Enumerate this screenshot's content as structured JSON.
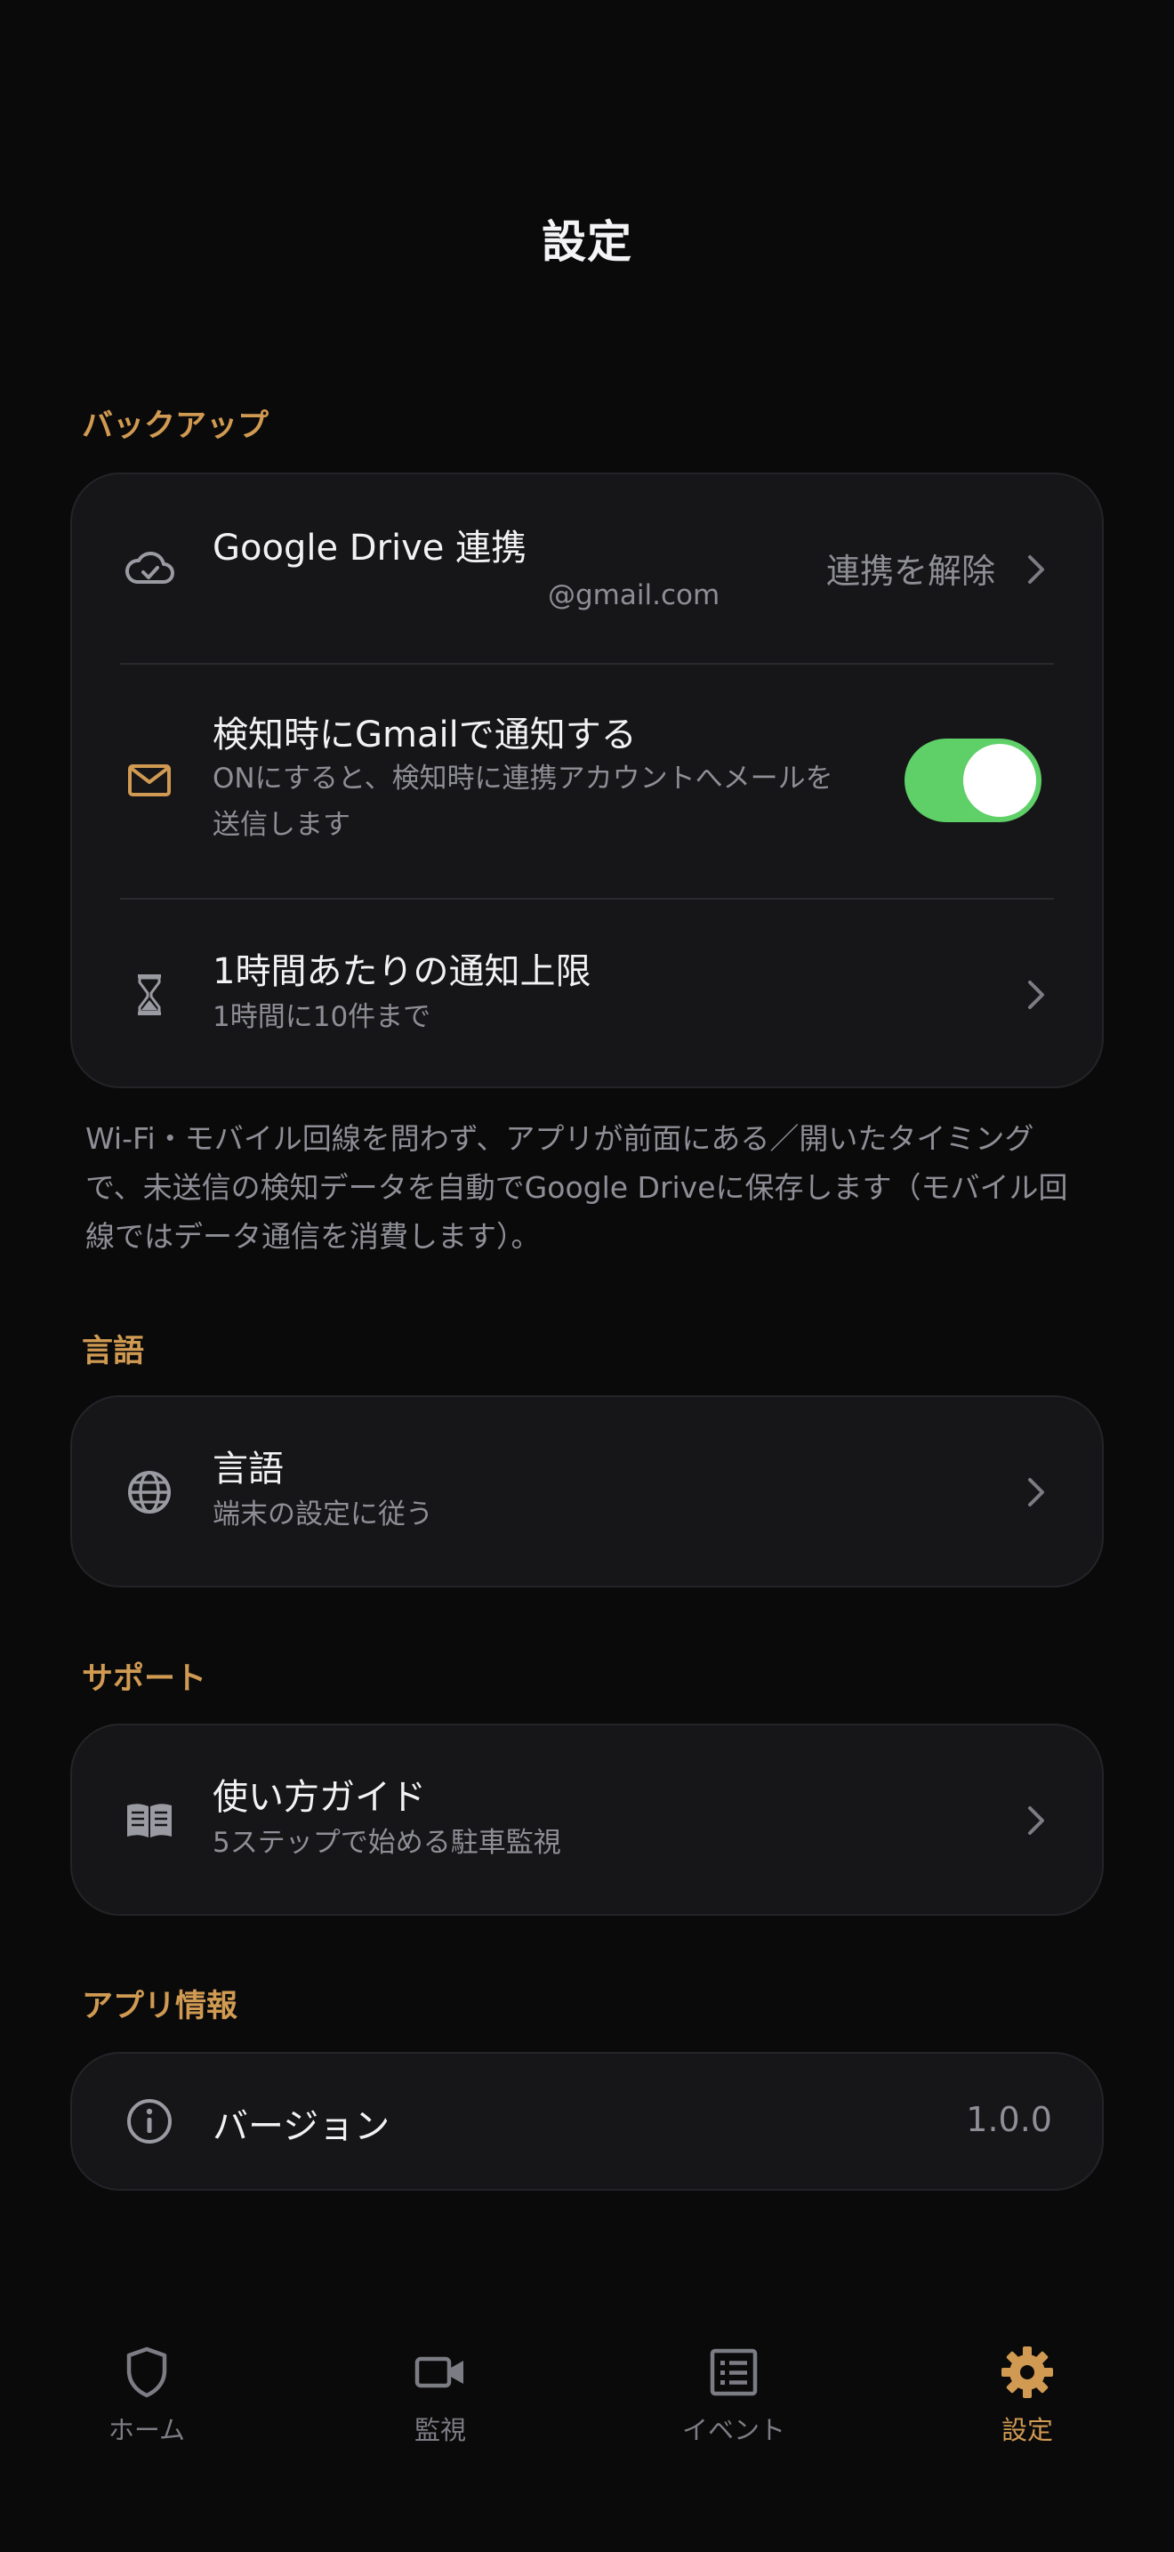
{
  "page": {
    "title": "設定"
  },
  "colors": {
    "background": "#0a0a0b",
    "card": "#161618",
    "accent": "#d09a52",
    "toggle_on": "#5fd068",
    "secondary_text": "#8e8e96"
  },
  "backup": {
    "section_title": "バックアップ",
    "drive": {
      "icon": "cloud-check-icon",
      "title": "Google Drive 連携",
      "account": "@gmail.com",
      "action": "連携を解除"
    },
    "gmail_notify": {
      "icon": "mail-icon",
      "title": "検知時にGmailで通知する",
      "description_line1": "ONにすると、検知時に連携アカウントへメールを",
      "description_line2": "送信します",
      "enabled": true
    },
    "rate_limit": {
      "icon": "hourglass-icon",
      "title": "1時間あたりの通知上限",
      "value": "1時間に10件まで"
    },
    "footnote_line1": "Wi-Fi・モバイル回線を問わず、アプリが前面にある／開いたタイミング",
    "footnote_line2": "で、未送信の検知データを自動でGoogle Driveに保存します（モバイル回",
    "footnote_line3": "線ではデータ通信を消費します）。"
  },
  "language": {
    "section_title": "言語",
    "item": {
      "icon": "globe-icon",
      "title": "言語",
      "value": "端末の設定に従う"
    }
  },
  "support": {
    "section_title": "サポート",
    "guide": {
      "icon": "book-icon",
      "title": "使い方ガイド",
      "subtitle": "5ステップで始める駐車監視"
    }
  },
  "app_info": {
    "section_title": "アプリ情報",
    "version": {
      "icon": "info-icon",
      "title": "バージョン",
      "value": "1.0.0"
    }
  },
  "tabbar": {
    "tabs": [
      {
        "label": "ホーム",
        "icon": "shield-icon",
        "active": false
      },
      {
        "label": "監視",
        "icon": "video-camera-icon",
        "active": false
      },
      {
        "label": "イベント",
        "icon": "list-icon",
        "active": false
      },
      {
        "label": "設定",
        "icon": "gear-icon",
        "active": true
      }
    ]
  }
}
